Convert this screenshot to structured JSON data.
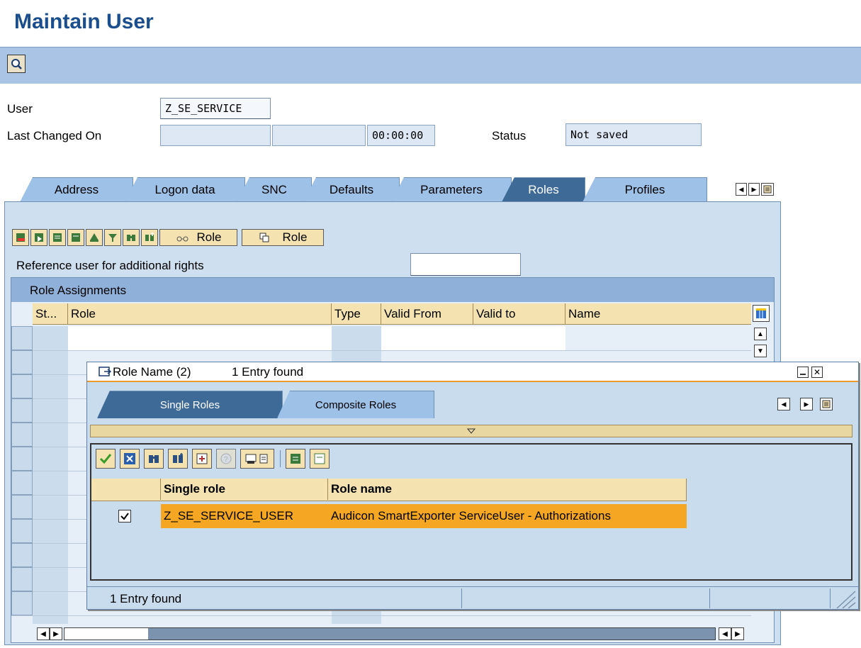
{
  "window": {
    "title": "Maintain User"
  },
  "header": {
    "user_label": "User",
    "user_value": "Z_SE_SERVICE",
    "changed_label": "Last Changed On",
    "changed_date": "",
    "changed_user": "",
    "changed_time": "00:00:00",
    "status_label": "Status",
    "status_value": "Not saved"
  },
  "tabs": [
    {
      "label": "Address"
    },
    {
      "label": "Logon data"
    },
    {
      "label": "SNC"
    },
    {
      "label": "Defaults"
    },
    {
      "label": "Parameters"
    },
    {
      "label": "Roles",
      "active": true
    },
    {
      "label": "Profiles"
    }
  ],
  "roles_tab": {
    "toolbar_role_btn1": "Role",
    "toolbar_role_btn2": "Role",
    "reference_label": "Reference user for additional rights",
    "reference_value": "",
    "table_title": "Role Assignments",
    "columns": [
      "St...",
      "Role",
      "Type",
      "Valid From",
      "Valid to",
      "Name"
    ]
  },
  "popup": {
    "title": "Role Name (2)",
    "title_count": "1 Entry found",
    "tabs": [
      {
        "label": "Single Roles",
        "active": true
      },
      {
        "label": "Composite Roles"
      }
    ],
    "columns": [
      "Single role",
      "Role name"
    ],
    "rows": [
      {
        "checked": true,
        "single_role": "Z_SE_SERVICE_USER",
        "role_name": "Audicon SmartExporter ServiceUser - Authorizations"
      }
    ],
    "status": "1 Entry found"
  },
  "colors": {
    "title_blue": "#1b4e8c",
    "toolbar_blue": "#a9c4e4",
    "tab_active": "#3e6a98",
    "tab_inactive": "#9ec1e8",
    "header_tan": "#f4e3b0",
    "row_highlight": "#f5a623"
  }
}
